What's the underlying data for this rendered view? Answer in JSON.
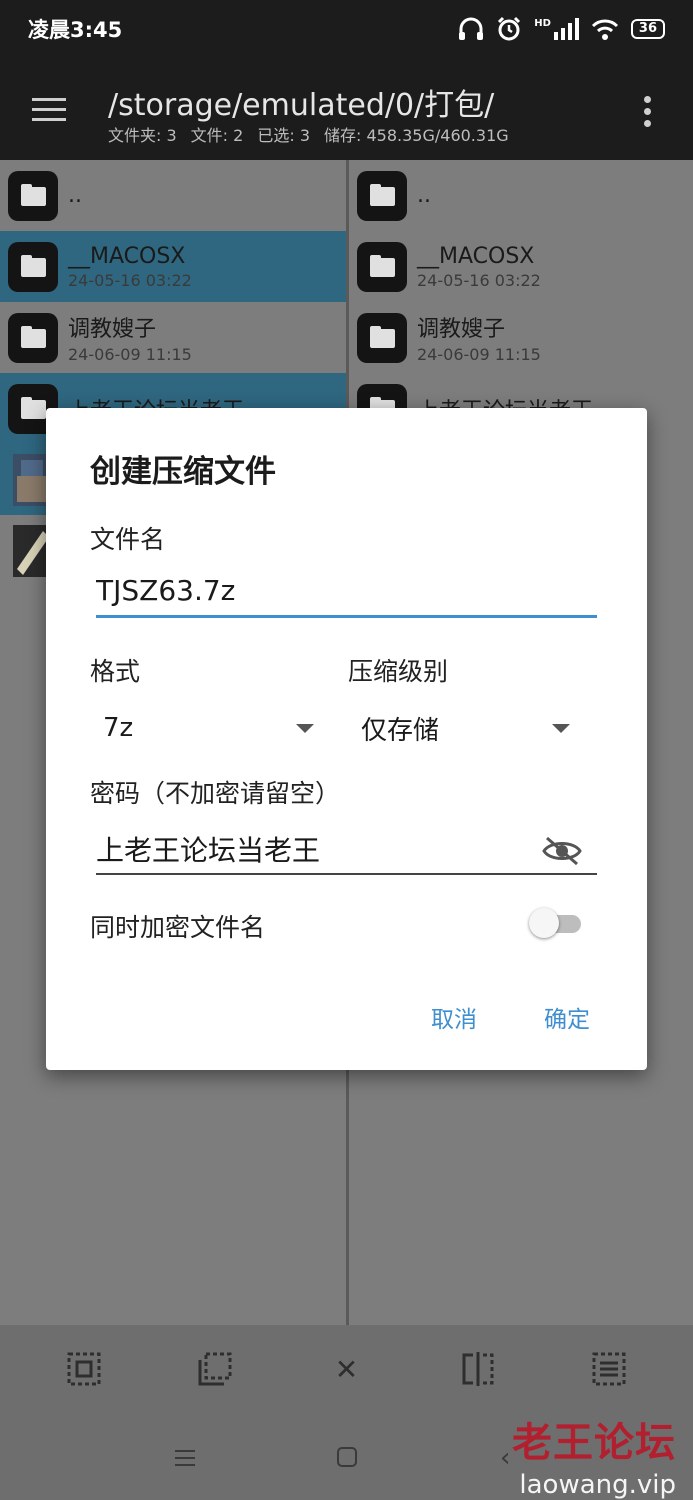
{
  "status_bar": {
    "time": "凌晨3:45",
    "hd_label": "HD",
    "battery": "36",
    "icons": [
      "headphones-icon",
      "alarm-icon",
      "signal-icon",
      "wifi-icon",
      "battery-icon"
    ]
  },
  "app_bar": {
    "path": "/storage/emulated/0/打包/",
    "folders": "文件夹: 3",
    "files": "文件: 2",
    "selected": "已选: 3",
    "storage": "储存: 458.35G/460.31G"
  },
  "left_pane": {
    "parent": "..",
    "rows": [
      {
        "name": "__MACOSX",
        "date": "24-05-16 03:22"
      },
      {
        "name": "调教嫂子",
        "date": "24-06-09 11:15"
      },
      {
        "name": "上老王论坛当老王",
        "date": ""
      }
    ]
  },
  "right_pane": {
    "parent": "..",
    "rows": [
      {
        "name": "__MACOSX",
        "date": "24-05-16 03:22"
      },
      {
        "name": "调教嫂子",
        "date": "24-06-09 11:15"
      },
      {
        "name": "上老王论坛当老王",
        "date": ""
      }
    ]
  },
  "dialog": {
    "title": "创建压缩文件",
    "filename_label": "文件名",
    "filename_value": "TJSZ63.7z",
    "format_label": "格式",
    "format_value": "7z",
    "level_label": "压缩级别",
    "level_value": "仅存储",
    "password_label": "密码（不加密请留空）",
    "password_value": "上老王论坛当老王",
    "encrypt_names_label": "同时加密文件名",
    "encrypt_names_on": false,
    "cancel": "取消",
    "ok": "确定",
    "accent": "#3f8fd0"
  },
  "bottom_bar": {
    "icons": [
      "select-all-icon",
      "select-range-icon",
      "close-icon",
      "compare-icon",
      "list-select-icon"
    ],
    "close_glyph": "✕"
  },
  "watermark": {
    "line1": "老王论坛",
    "line2": "laowang.vip",
    "color": "#b2202f"
  }
}
